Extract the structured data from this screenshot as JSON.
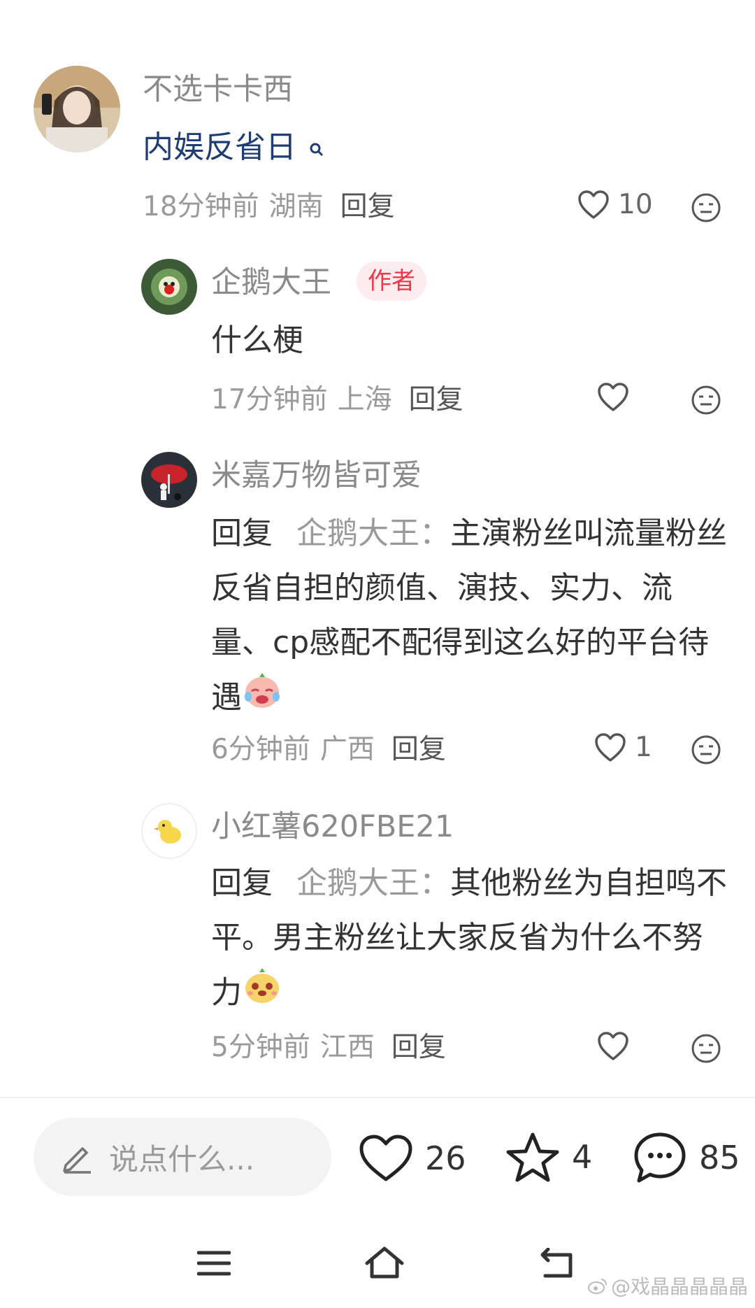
{
  "comments": [
    {
      "username": "不选卡卡西",
      "text": "内娱反省日",
      "search_icon": "search-icon",
      "time": "18分钟前",
      "location": "湖南",
      "reply_label": "回复",
      "likes": "10"
    },
    {
      "username": "企鹅大王",
      "badge": "作者",
      "text": "什么梗",
      "time": "17分钟前",
      "location": "上海",
      "reply_label": "回复",
      "likes": ""
    },
    {
      "username": "米嘉万物皆可爱",
      "reply_prefix": "回复",
      "reply_to": "企鹅大王：",
      "text": "主演粉丝叫流量粉丝反省自担的颜值、演技、实力、流量、cp感配不配得到这么好的平台待遇",
      "emoji": "crying-laugh-emoji",
      "time": "6分钟前",
      "location": "广西",
      "reply_label": "回复",
      "likes": "1"
    },
    {
      "username": "小红薯620FBE21",
      "reply_prefix": "回复",
      "reply_to": "企鹅大王：",
      "text": "其他粉丝为自担鸣不平。男主粉丝让大家反省为什么不努力",
      "emoji": "peeking-emoji",
      "time": "5分钟前",
      "location": "江西",
      "reply_label": "回复",
      "likes": ""
    }
  ],
  "bottom_bar": {
    "input_placeholder": "说点什么...",
    "likes_count": "26",
    "favorites_count": "4",
    "comments_count": "85"
  },
  "watermark": "@戏晶晶晶晶晶",
  "colors": {
    "badge_bg": "#fdecee",
    "badge_text": "#f0364a",
    "link_blue": "#1f3d72"
  }
}
